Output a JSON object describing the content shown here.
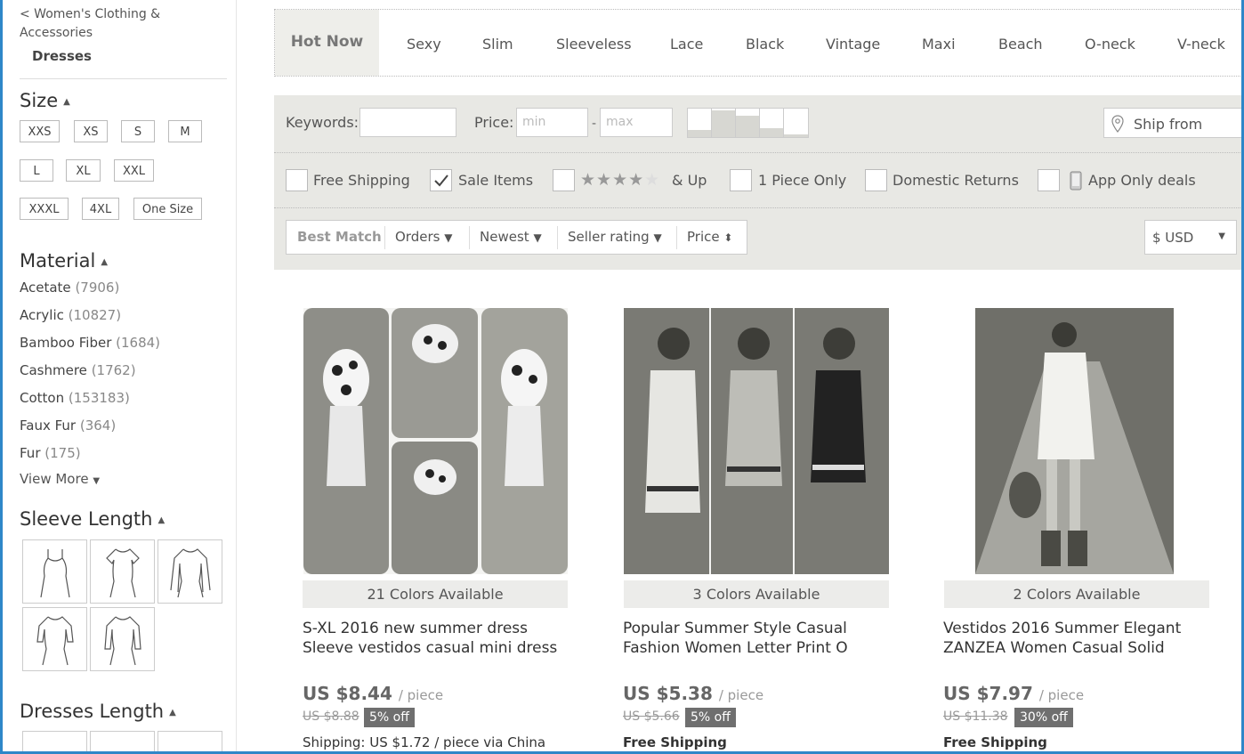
{
  "sidebar": {
    "back_link": "< Women's Clothing & Accessories",
    "current_category": "Dresses",
    "size": {
      "title": "Size",
      "options": [
        "XXS",
        "XS",
        "S",
        "M",
        "L",
        "XL",
        "XXL",
        "XXXL",
        "4XL",
        "One Size"
      ]
    },
    "material": {
      "title": "Material",
      "items": [
        {
          "name": "Acetate",
          "count": "(7906)"
        },
        {
          "name": "Acrylic",
          "count": "(10827)"
        },
        {
          "name": "Bamboo Fiber",
          "count": "(1684)"
        },
        {
          "name": "Cashmere",
          "count": "(1762)"
        },
        {
          "name": "Cotton",
          "count": "(153183)"
        },
        {
          "name": "Faux Fur",
          "count": "(364)"
        },
        {
          "name": "Fur",
          "count": "(175)"
        }
      ],
      "view_more": "View More"
    },
    "sleeve_length": {
      "title": "Sleeve Length"
    },
    "dresses_length": {
      "title": "Dresses Length"
    }
  },
  "tags": {
    "hot": "Hot Now",
    "items": [
      "Sexy",
      "Slim",
      "Sleeveless",
      "Lace",
      "Black",
      "Vintage",
      "Maxi",
      "Beach",
      "O-neck",
      "V-neck"
    ]
  },
  "filters": {
    "keywords_label": "Keywords:",
    "price_label": "Price:",
    "min_placeholder": "min",
    "max_placeholder": "max",
    "ship_from": "Ship from",
    "free_shipping": "Free Shipping",
    "sale_items": "Sale Items",
    "stars_suffix": "& Up",
    "one_piece": "1 Piece Only",
    "domestic_returns": "Domestic Returns",
    "app_only": "App Only deals"
  },
  "sort": {
    "best_match": "Best Match",
    "orders": "Orders",
    "newest": "Newest",
    "seller_rating": "Seller rating",
    "price": "Price",
    "currency": "$ USD"
  },
  "products": [
    {
      "colors": "21 Colors Available",
      "title_line1": "S-XL 2016 new summer dress",
      "title_line2": "Sleeve vestidos casual mini dress",
      "price": "US $8.44",
      "unit": "/ piece",
      "old_price": "US $8.88",
      "discount": "5% off",
      "shipping": "Shipping: US $1.72 / piece via China"
    },
    {
      "colors": "3 Colors Available",
      "title_line1": "Popular Summer Style Casual",
      "title_line2": "Fashion Women Letter Print O",
      "price": "US $5.38",
      "unit": "/ piece",
      "old_price": "US $5.66",
      "discount": "5% off",
      "shipping": "Free Shipping"
    },
    {
      "colors": "2 Colors Available",
      "title_line1": "Vestidos 2016 Summer Elegant",
      "title_line2": "ZANZEA Women Casual Solid",
      "price": "US $7.97",
      "unit": "/ piece",
      "old_price": "US $11.38",
      "discount": "30% off",
      "shipping": "Free Shipping"
    }
  ]
}
